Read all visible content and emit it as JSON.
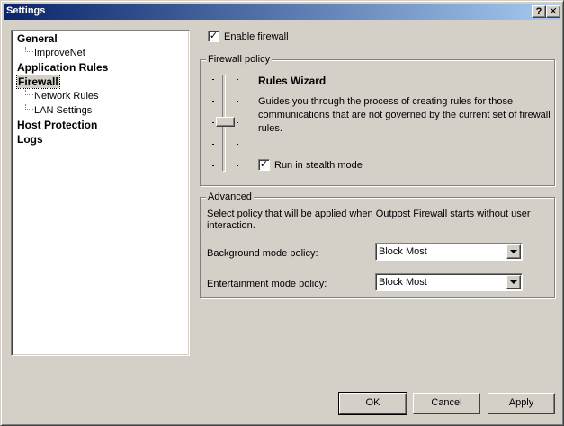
{
  "window": {
    "title": "Settings",
    "help_button": "?",
    "close_button": "✕"
  },
  "nav": {
    "items": [
      {
        "label": "General",
        "level": 0
      },
      {
        "label": "ImproveNet",
        "level": 1
      },
      {
        "label": "Application Rules",
        "level": 0
      },
      {
        "label": "Firewall",
        "level": 0,
        "selected": true
      },
      {
        "label": "Network Rules",
        "level": 1
      },
      {
        "label": "LAN Settings",
        "level": 1
      },
      {
        "label": "Host Protection",
        "level": 0
      },
      {
        "label": "Logs",
        "level": 0
      }
    ]
  },
  "firewall": {
    "enable_label": "Enable firewall",
    "enable_checked": true
  },
  "policy": {
    "legend": "Firewall policy",
    "current_title": "Rules Wizard",
    "description": "Guides you through the process of creating rules for those communications that are not governed by the current set of firewall rules.",
    "stealth_label": "Run in stealth mode",
    "stealth_checked": true
  },
  "advanced": {
    "legend": "Advanced",
    "description": "Select policy that will be applied when Outpost Firewall starts without user interaction.",
    "background_label": "Background mode policy:",
    "background_value": "Block Most",
    "entertainment_label": "Entertainment mode policy:",
    "entertainment_value": "Block Most"
  },
  "buttons": {
    "ok": "OK",
    "cancel": "Cancel",
    "apply": "Apply"
  }
}
